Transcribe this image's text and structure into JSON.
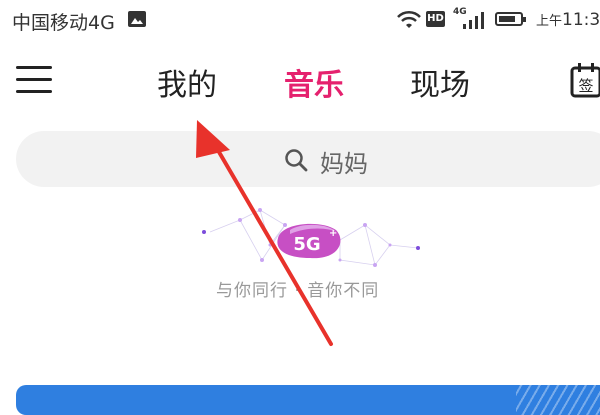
{
  "status_bar": {
    "carrier": "中国移动4G",
    "network": "4G",
    "hd_badge": "HD",
    "ampm": "上午",
    "time": "11:3"
  },
  "nav": {
    "tabs": [
      {
        "label": "我的",
        "active": false
      },
      {
        "label": "音乐",
        "active": true
      },
      {
        "label": "现场",
        "active": false
      }
    ],
    "calendar_glyph": "签"
  },
  "search": {
    "placeholder": "妈妈"
  },
  "promo": {
    "badge": "5G",
    "tagline": "与你同行 · 音你不同"
  },
  "colors": {
    "accent": "#e5216e",
    "arrow": "#e8322b",
    "banner": "#2f7fe0"
  },
  "icons": [
    "image-icon",
    "wifi-icon",
    "signal-icon",
    "battery-icon",
    "menu-icon",
    "calendar-icon",
    "search-icon"
  ]
}
